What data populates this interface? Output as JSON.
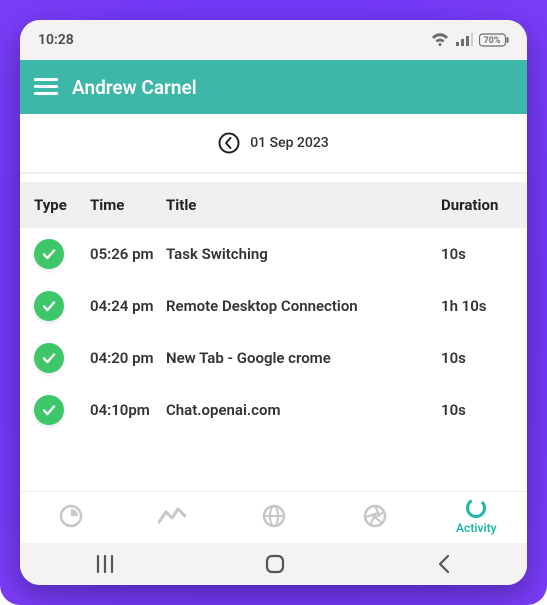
{
  "status": {
    "time": "10:28",
    "battery": "70%"
  },
  "header": {
    "title": "Andrew Carnel"
  },
  "date": "01 Sep 2023",
  "columns": {
    "type": "Type",
    "time": "Time",
    "title": "Title",
    "duration": "Duration"
  },
  "rows": [
    {
      "time": "05:26 pm",
      "title": "Task Switching",
      "duration": "10s"
    },
    {
      "time": "04:24 pm",
      "title": "Remote Desktop Connection",
      "duration": "1h 10s"
    },
    {
      "time": "04:20 pm",
      "title": "New Tab - Google crome",
      "duration": "10s"
    },
    {
      "time": "04:10pm",
      "title": "Chat.openai.com",
      "duration": "10s"
    }
  ],
  "tabs": {
    "activity": "Activity"
  }
}
